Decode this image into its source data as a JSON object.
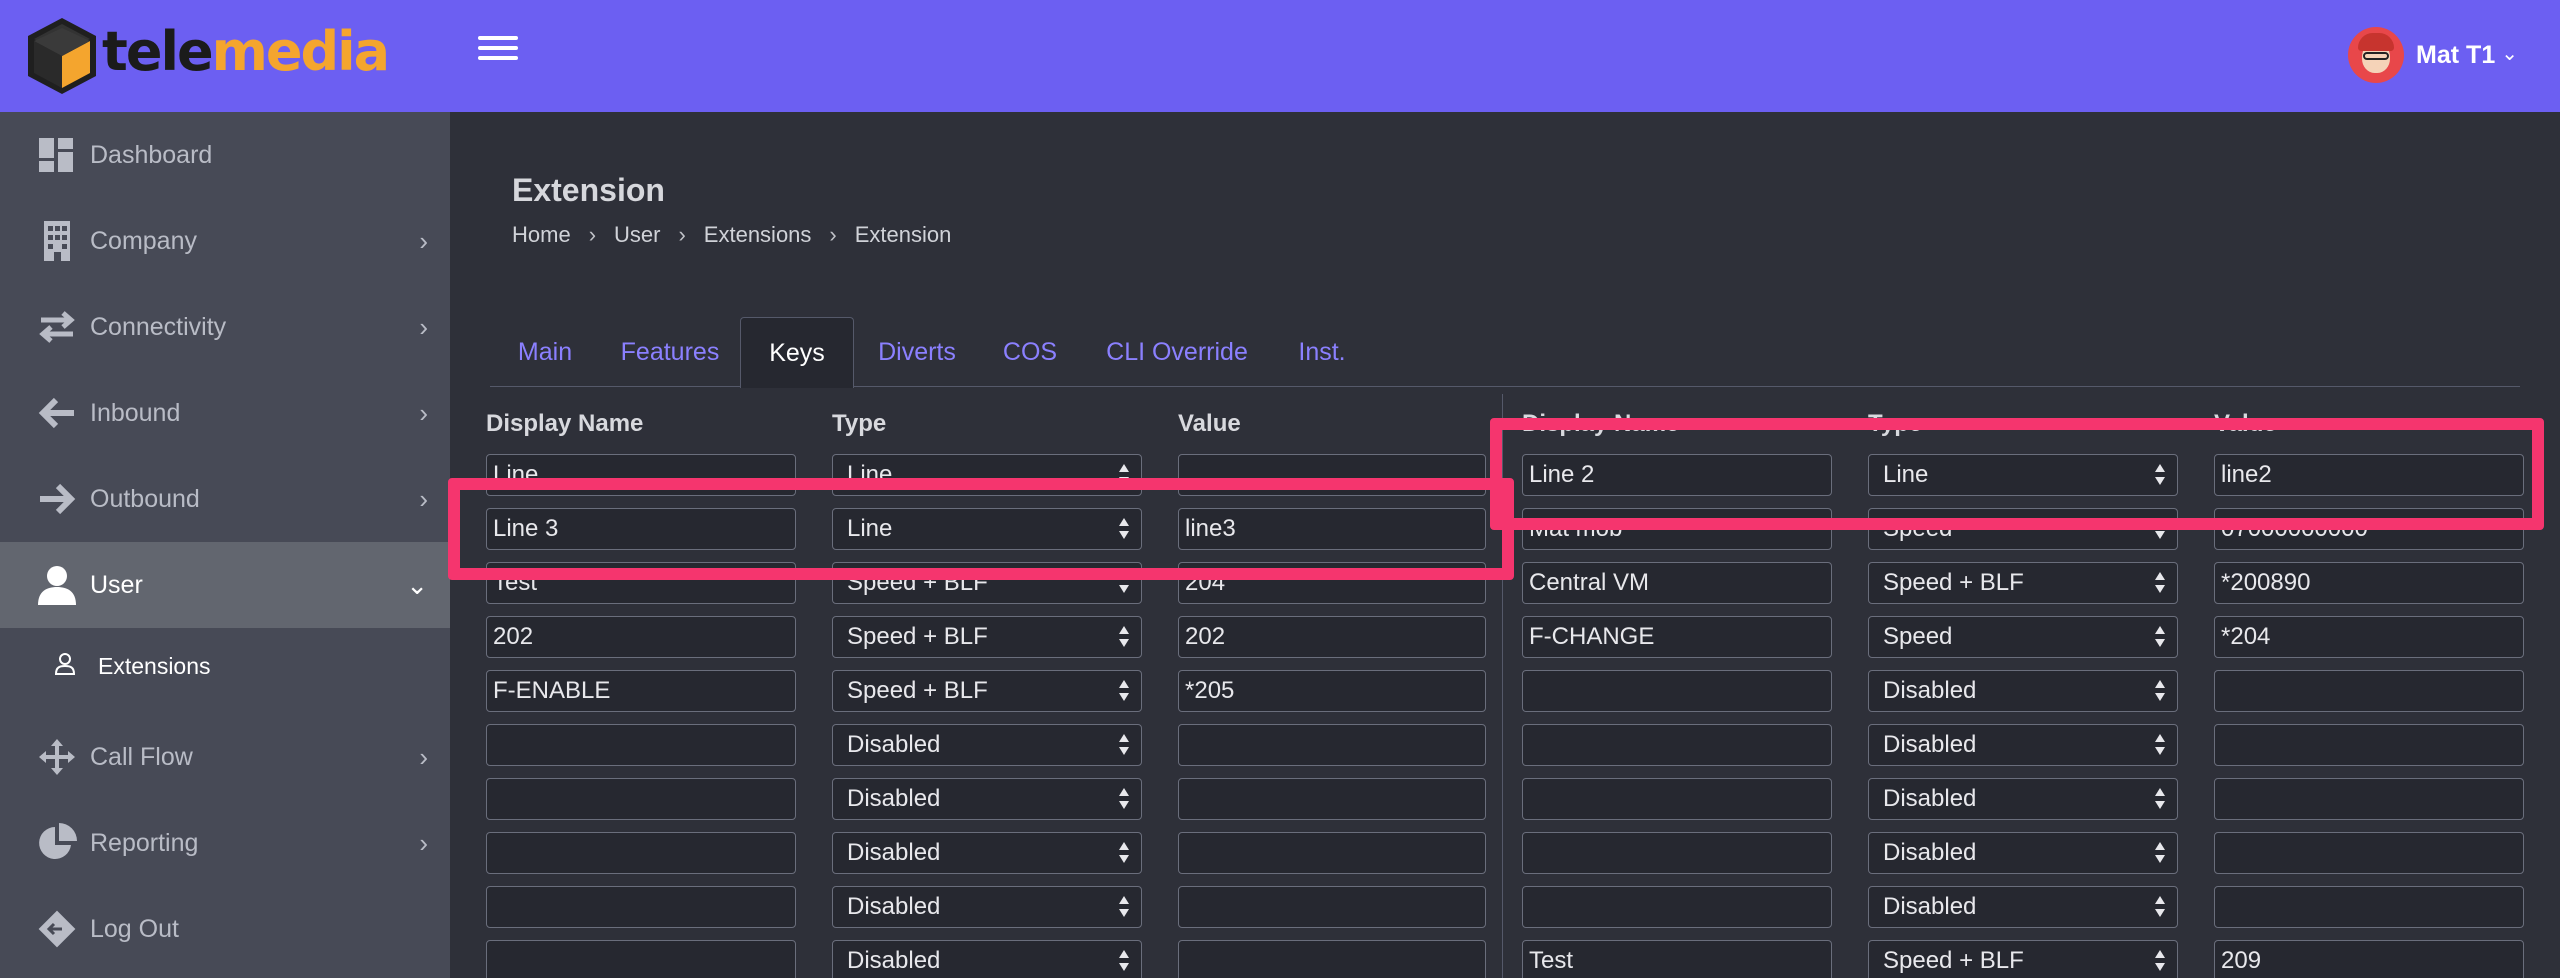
{
  "header": {
    "logo_part1": "tele",
    "logo_part2": "media",
    "user_name": "Mat T1"
  },
  "sidebar": {
    "items": [
      {
        "label": "Dashboard",
        "icon": "dashboard-icon"
      },
      {
        "label": "Company",
        "icon": "building-icon"
      },
      {
        "label": "Connectivity",
        "icon": "arrows-exchange-icon"
      },
      {
        "label": "Inbound",
        "icon": "arrow-left-icon"
      },
      {
        "label": "Outbound",
        "icon": "arrow-right-icon"
      },
      {
        "label": "User",
        "icon": "user-icon"
      },
      {
        "label": "Call Flow",
        "icon": "move-arrows-icon"
      },
      {
        "label": "Reporting",
        "icon": "pie-chart-icon"
      },
      {
        "label": "Log Out",
        "icon": "logout-icon"
      }
    ],
    "sub_items": [
      {
        "label": "Extensions",
        "icon": "user-outline-icon"
      }
    ]
  },
  "page": {
    "title": "Extension",
    "breadcrumb": [
      "Home",
      "User",
      "Extensions",
      "Extension"
    ]
  },
  "tabs": [
    "Main",
    "Features",
    "Keys",
    "Diverts",
    "COS",
    "CLI Override",
    "Inst."
  ],
  "active_tab": "Keys",
  "keys": {
    "headers": {
      "display_name": "Display Name",
      "type": "Type",
      "value": "Value"
    },
    "left": [
      {
        "name": "Line",
        "type": "Line",
        "value": ""
      },
      {
        "name": "Line 3",
        "type": "Line",
        "value": "line3"
      },
      {
        "name": "Test",
        "type": "Speed + BLF",
        "value": "204"
      },
      {
        "name": "202",
        "type": "Speed + BLF",
        "value": "202"
      },
      {
        "name": "F-ENABLE",
        "type": "Speed + BLF",
        "value": "*205"
      },
      {
        "name": "",
        "type": "Disabled",
        "value": ""
      },
      {
        "name": "",
        "type": "Disabled",
        "value": ""
      },
      {
        "name": "",
        "type": "Disabled",
        "value": ""
      },
      {
        "name": "",
        "type": "Disabled",
        "value": ""
      },
      {
        "name": "",
        "type": "Disabled",
        "value": ""
      }
    ],
    "right": [
      {
        "name": "Line 2",
        "type": "Line",
        "value": "line2"
      },
      {
        "name": "Mat mob",
        "type": "Speed",
        "value": "07000000000"
      },
      {
        "name": "Central VM",
        "type": "Speed + BLF",
        "value": "*200890"
      },
      {
        "name": "F-CHANGE",
        "type": "Speed",
        "value": "*204"
      },
      {
        "name": "",
        "type": "Disabled",
        "value": ""
      },
      {
        "name": "",
        "type": "Disabled",
        "value": ""
      },
      {
        "name": "",
        "type": "Disabled",
        "value": ""
      },
      {
        "name": "",
        "type": "Disabled",
        "value": ""
      },
      {
        "name": "",
        "type": "Disabled",
        "value": ""
      },
      {
        "name": "Test",
        "type": "Speed + BLF",
        "value": "209"
      }
    ]
  },
  "colors": {
    "header": "#6c5ff2",
    "sidebar": "#474a56",
    "accent": "#8b80ff",
    "highlight": "#f5356e",
    "logo_orange": "#f4a52e"
  }
}
